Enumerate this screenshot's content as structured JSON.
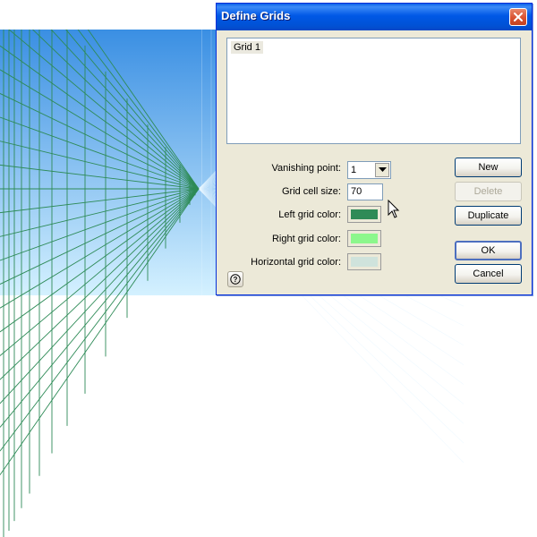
{
  "canvas": {
    "sky_top": "#3a8fe3",
    "sky_bottom": "#d4f1ff",
    "left_grid_color": "#2e8b57",
    "tile_dark": "#b3333a",
    "tile_light": "#ffffcc"
  },
  "dialog": {
    "title": "Define Grids",
    "close_icon": "close-icon",
    "grid_list": [
      "Grid 1"
    ],
    "vanishing_point_label": "Vanishing point:",
    "vanishing_point_value": "1",
    "cell_size_label": "Grid cell size:",
    "cell_size_value": "70",
    "left_color_label": "Left grid color:",
    "left_color": "#2e8b57",
    "right_color_label": "Right grid color:",
    "right_color": "#8cf78c",
    "horizontal_color_label": "Horizontal grid color:",
    "horizontal_color": "#cfe3dc",
    "buttons": {
      "new": "New",
      "delete": "Delete",
      "duplicate": "Duplicate",
      "ok": "OK",
      "cancel": "Cancel"
    },
    "help_icon": "help-icon"
  }
}
